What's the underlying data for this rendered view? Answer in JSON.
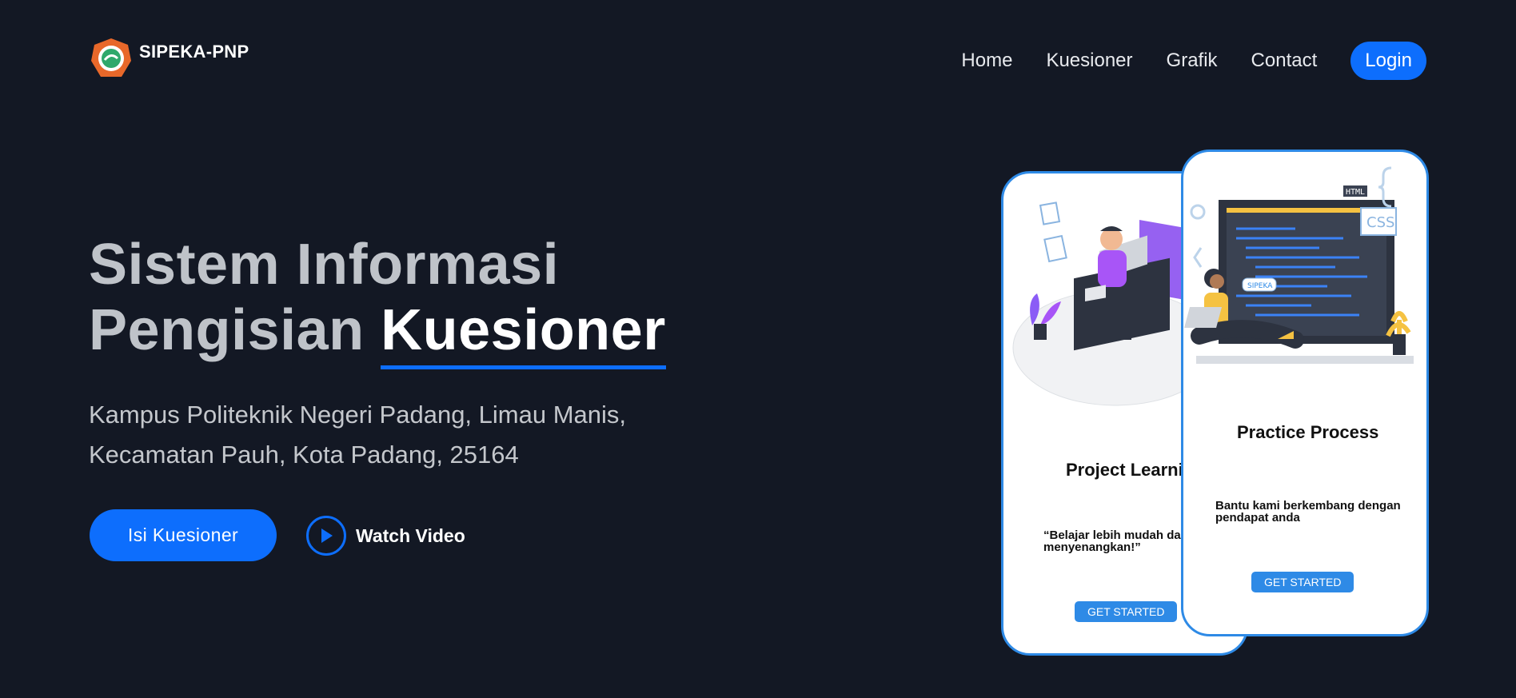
{
  "brand": {
    "name": "SIPEKA-PNP",
    "colors": {
      "primary": "#0d6efd",
      "background": "#131824",
      "logo_orange": "#e8682a"
    }
  },
  "nav": {
    "items": [
      "Home",
      "Kuesioner",
      "Grafik",
      "Contact"
    ],
    "login": "Login"
  },
  "hero": {
    "title_line1": "Sistem Informasi",
    "title_line2_prefix": "Pengisian",
    "title_highlight": "Kuesioner",
    "address": "Kampus Politeknik Negeri Padang, Limau Manis, Kecamatan Pauh, Kota Padang, 25164",
    "primary_button": "Isi Kuesioner",
    "secondary_button": "Watch Video"
  },
  "phones": [
    {
      "title": "Project Learning",
      "quote": "“Belajar lebih mudah dan menyenangkan!”",
      "cta": "GET STARTED"
    },
    {
      "title": "Practice Process",
      "quote": "Bantu kami berkembang dengan pendapat anda",
      "cta": "GET STARTED",
      "illustration_labels": {
        "html": "HTML",
        "css": "CSS",
        "bubble": "SIPEKA"
      }
    }
  ],
  "icons": [
    "logo-badge-icon",
    "play-icon",
    "developer-illustration",
    "coding-illustration"
  ]
}
